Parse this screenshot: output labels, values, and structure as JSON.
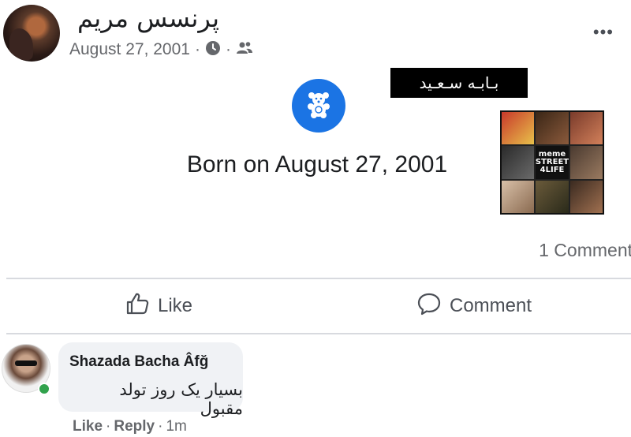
{
  "post": {
    "author": "پرنسس مریم",
    "date": "August 27, 2001",
    "separator": "·",
    "privacy_icon": "friends-icon",
    "clock_icon": "clock-icon",
    "more_icon": "•••"
  },
  "life_event": {
    "icon": "teddy-bear-icon",
    "text": "Born on August 27, 2001"
  },
  "overlay": {
    "label": "بـابـه سـعـید",
    "image_text_lines": [
      "meme",
      "STREET",
      "4LIFE"
    ]
  },
  "stats": {
    "comments": "1 Comment"
  },
  "actions": {
    "like": "Like",
    "comment": "Comment"
  },
  "comment": {
    "author": "Shazada Bacha Âfğ",
    "text": "بسیار یک روز تولد مقبول",
    "like": "Like",
    "reply": "Reply",
    "time": "1m",
    "dot": "·"
  },
  "colors": {
    "brand_blue": "#1b74e4",
    "online_green": "#31a24c",
    "secondary_text": "#65676b"
  }
}
